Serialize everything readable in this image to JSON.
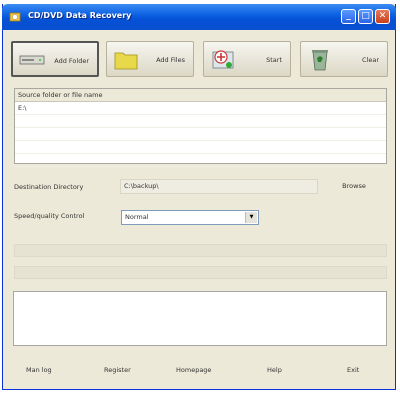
{
  "window": {
    "title": "CD/DVD Data Recovery"
  },
  "titlebar_buttons": {
    "minimize": "_",
    "maximize": "□",
    "close": "✕"
  },
  "toolbar": {
    "add_folder": "Add Folder",
    "add_files": "Add Files",
    "start": "Start",
    "clear": "Clear"
  },
  "source_list": {
    "header": "Source folder or file name",
    "rows": [
      "E:\\",
      "",
      "",
      "",
      ""
    ]
  },
  "destination": {
    "label": "Destination Directory",
    "value": "C:\\backup\\",
    "browse": "Browse"
  },
  "speed": {
    "label": "Speed/quality Control",
    "value": "Normal"
  },
  "footer": {
    "manlog": "Man log",
    "register": "Register",
    "homepage": "Homepage",
    "help": "Help",
    "exit": "Exit"
  },
  "colors": {
    "titlebar": "#0a5ee0",
    "panel": "#ece9d8",
    "folder": "#e8d94a"
  }
}
